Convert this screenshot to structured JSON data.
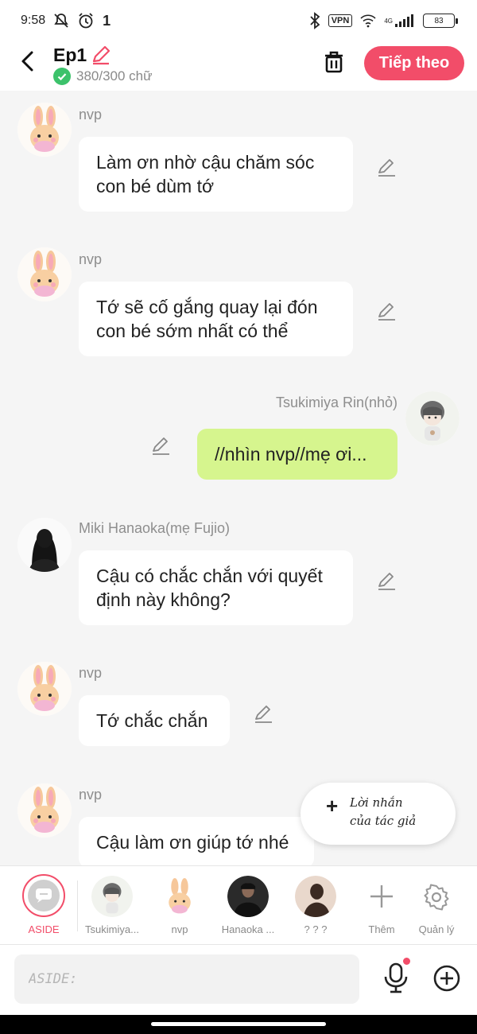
{
  "status_bar": {
    "time": "9:58",
    "temp": "1",
    "vpn": "VPN",
    "network": "4G",
    "battery": "83"
  },
  "header": {
    "episode_title": "Ep1",
    "word_count": "380/300 chữ",
    "next_label": "Tiếp theo"
  },
  "messages": [
    {
      "sender": "nvp",
      "text_line1": "Làm ơn nhờ cậu chăm sóc",
      "text_line2": "con bé dùm tớ"
    },
    {
      "sender": "nvp",
      "text_line1": "Tớ sẽ cố gắng quay lại đón",
      "text_line2": "con bé sớm nhất có thể"
    },
    {
      "sender": "Tsukimiya Rin(nhỏ)",
      "text": "//nhìn nvp//mẹ ơi..."
    },
    {
      "sender": "Miki Hanaoka(mẹ Fujio)",
      "text_line1": "Cậu có chắc chắn với quyết",
      "text_line2": "định này không?"
    },
    {
      "sender": "nvp",
      "text": "Tớ chắc chắn"
    },
    {
      "sender": "nvp",
      "text": "Cậu làm ơn giúp tớ nhé"
    }
  ],
  "author_note": {
    "line1": "Lời nhắn",
    "line2": "của tác giả"
  },
  "characters": [
    {
      "label": "ASIDE"
    },
    {
      "label": "Tsukimiya..."
    },
    {
      "label": "nvp"
    },
    {
      "label": "Hanaoka ..."
    },
    {
      "label": "? ? ?"
    },
    {
      "label": "Thêm"
    },
    {
      "label": "Quản lý"
    }
  ],
  "input": {
    "placeholder": "ASIDE:"
  },
  "colors": {
    "accent": "#f24d69",
    "my_bubble": "#d6f58e",
    "check": "#3cc26b"
  }
}
